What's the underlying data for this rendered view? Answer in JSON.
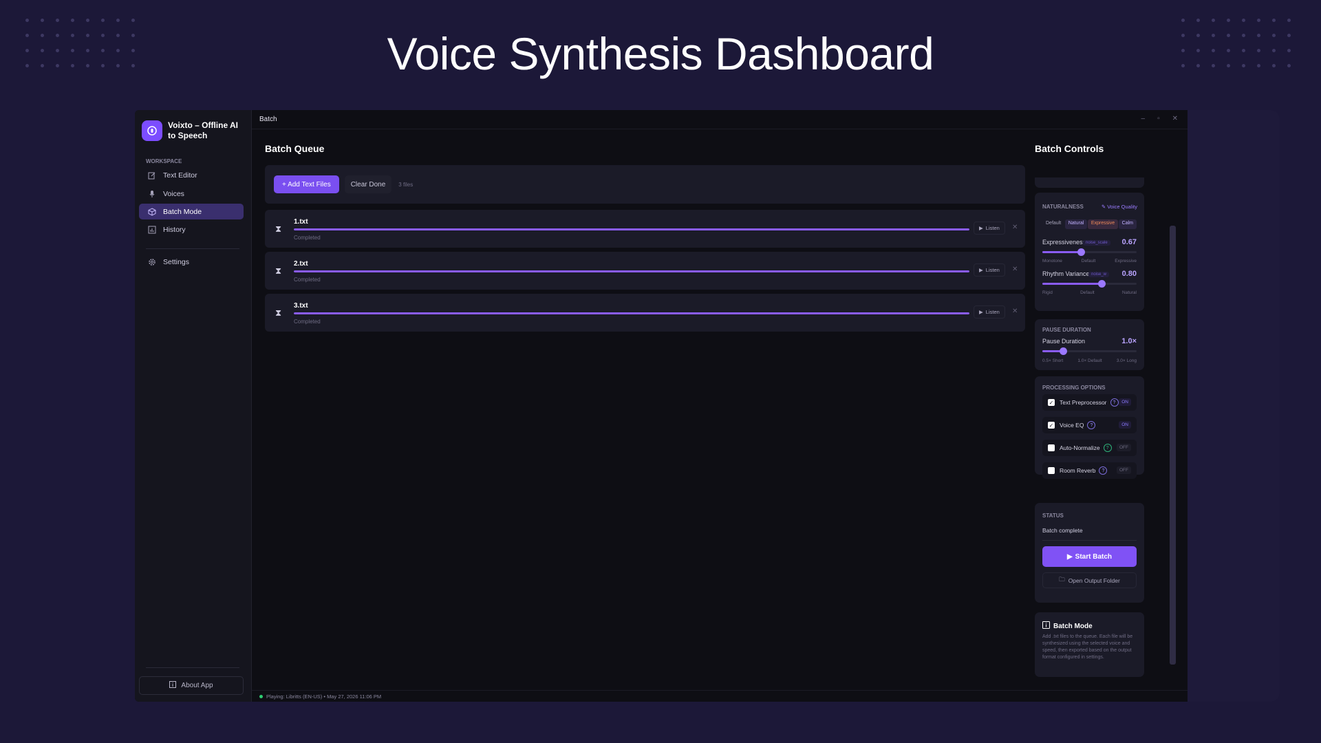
{
  "hero": {
    "title": "Voice Synthesis Dashboard"
  },
  "sidebar": {
    "app_title": "Voixto – Offline AI to Speech",
    "section_label": "WORKSPACE",
    "items": [
      {
        "label": "Text Editor",
        "icon": "edit-icon"
      },
      {
        "label": "Voices",
        "icon": "microphone-icon"
      },
      {
        "label": "Batch Mode",
        "icon": "box-icon",
        "active": true
      },
      {
        "label": "History",
        "icon": "chart-icon"
      }
    ],
    "settings_label": "Settings",
    "about_label": "About App"
  },
  "titlebar": {
    "title": "Batch"
  },
  "main": {
    "title": "Batch Queue",
    "add_label": "+ Add Text Files",
    "clear_label": "Clear Done",
    "file_count": "3 files",
    "queue": [
      {
        "name": "1.txt",
        "status": "Completed",
        "progress": 1.0,
        "listen": "Listen"
      },
      {
        "name": "2.txt",
        "status": "Completed",
        "progress": 1.0,
        "listen": "Listen"
      },
      {
        "name": "3.txt",
        "status": "Completed",
        "progress": 1.0,
        "listen": "Listen"
      }
    ]
  },
  "controls": {
    "title": "Batch Controls",
    "naturalness": {
      "label": "NATURALNESS",
      "voice_quality": "Voice Quality",
      "presets": [
        "Default",
        "Natural",
        "Expressive",
        "Calm"
      ],
      "expressiveness": {
        "label": "Expressiveness",
        "tag": "noise_scale",
        "value": "0.67",
        "fraction": 0.41,
        "min": "Monotone",
        "mid": "Default",
        "max": "Expressive"
      },
      "rhythm": {
        "label": "Rhythm Variance",
        "tag": "noise_w",
        "value": "0.80",
        "fraction": 0.63,
        "min": "Rigid",
        "mid": "Default",
        "max": "Natural"
      }
    },
    "pause": {
      "label": "PAUSE DURATION",
      "name": "Pause Duration",
      "value": "1.0×",
      "fraction": 0.22,
      "min": "0.5× Short",
      "mid": "1.0× Default",
      "max": "3.0× Long"
    },
    "processing": {
      "label": "PROCESSING OPTIONS",
      "options": [
        {
          "label": "Text Preprocessor",
          "checked": true,
          "state": "ON"
        },
        {
          "label": "Voice EQ",
          "checked": true,
          "state": "ON"
        },
        {
          "label": "Auto-Normalize",
          "checked": false,
          "state": "OFF"
        },
        {
          "label": "Room Reverb",
          "checked": false,
          "state": "OFF"
        }
      ]
    },
    "status": {
      "label": "STATUS",
      "text": "Batch complete",
      "start_label": "Start Batch",
      "output_label": "Open Output Folder"
    },
    "info": {
      "title": "Batch Mode",
      "desc": "Add .txt files to the queue. Each file will be synthesized using the selected voice and speed, then exported based on the output format configured in settings."
    }
  },
  "statusbar": {
    "text": "Playing: Libritts (EN-US) • May 27, 2026  11:06 PM"
  },
  "colors": {
    "accent": "#7c4dff",
    "background": "#1c1838",
    "app_bg": "#0e0e14"
  }
}
